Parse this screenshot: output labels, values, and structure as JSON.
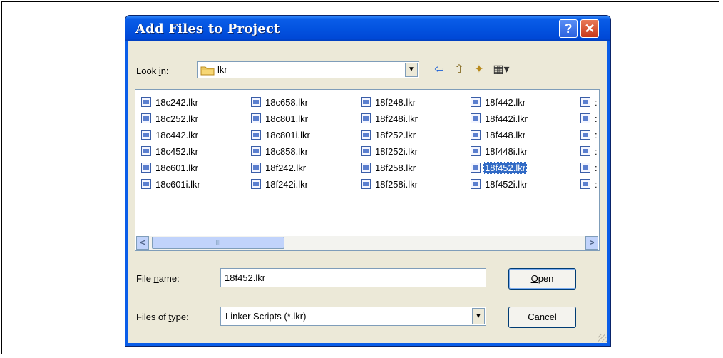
{
  "window": {
    "title": "Add Files to Project"
  },
  "titlebar": {
    "help_glyph": "?",
    "close_glyph": "✕"
  },
  "lookin": {
    "label_pre": "Look ",
    "label_u": "i",
    "label_post": "n:",
    "value": "lkr",
    "arrow": "▼"
  },
  "toolbar": {
    "back": "⇦",
    "up": "⇧",
    "new_folder": "✦",
    "view": "▦▾"
  },
  "files": {
    "columns": [
      [
        "18c242.lkr",
        "18c252.lkr",
        "18c442.lkr",
        "18c452.lkr",
        "18c601.lkr",
        "18c601i.lkr"
      ],
      [
        "18c658.lkr",
        "18c801.lkr",
        "18c801i.lkr",
        "18c858.lkr",
        "18f242.lkr",
        "18f242i.lkr"
      ],
      [
        "18f248.lkr",
        "18f248i.lkr",
        "18f252.lkr",
        "18f252i.lkr",
        "18f258.lkr",
        "18f258i.lkr"
      ],
      [
        "18f442.lkr",
        "18f442i.lkr",
        "18f448.lkr",
        "18f448i.lkr",
        "18f452.lkr",
        "18f452i.lkr"
      ]
    ],
    "partial_column": [
      ":",
      ":",
      ":",
      ":",
      ":",
      ":"
    ],
    "selected": "18f452.lkr"
  },
  "scrollbar": {
    "left": "<",
    "right": ">",
    "grip": "III"
  },
  "filename": {
    "label_pre": "File ",
    "label_u": "n",
    "label_post": "ame:",
    "value": "18f452.lkr"
  },
  "filetype": {
    "label_pre": "Files of ",
    "label_u": "t",
    "label_post": "ype:",
    "value": "Linker Scripts (*.lkr)",
    "arrow": "▼"
  },
  "buttons": {
    "open_u": "O",
    "open_rest": "pen",
    "cancel": "Cancel"
  }
}
